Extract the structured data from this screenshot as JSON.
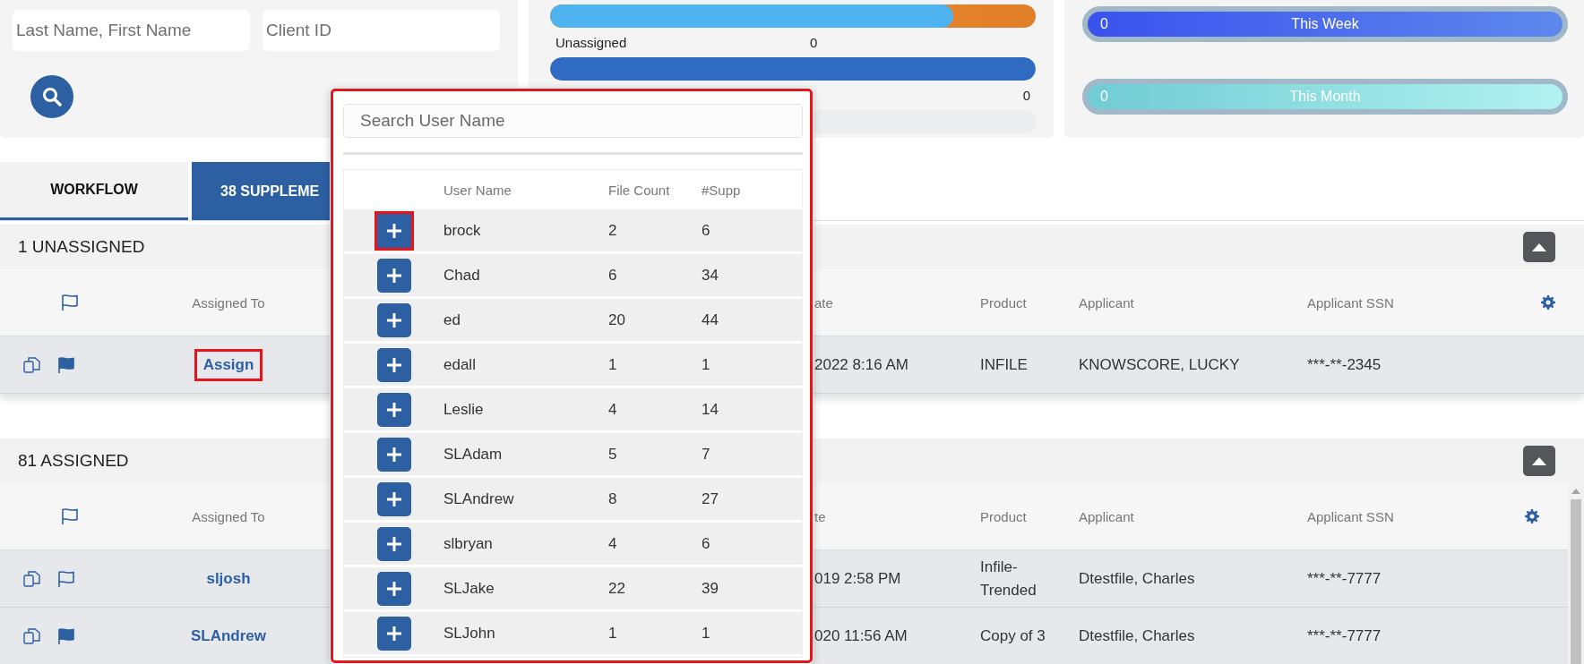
{
  "search_panel": {
    "fields": [
      {
        "placeholder": "Last Name, First Name"
      },
      {
        "placeholder": "Client ID"
      }
    ]
  },
  "status_bars": [
    {
      "kind": "split",
      "level": 0.83
    },
    {
      "kind": "plain",
      "label": "Unassigned",
      "value": "0",
      "level": 1
    },
    {
      "kind": "plain",
      "value": "0",
      "level": 0
    }
  ],
  "period_meters": [
    {
      "kind": "week",
      "value": "0",
      "label": "This Week"
    },
    {
      "kind": "month",
      "value": "0",
      "label": "This Month"
    }
  ],
  "tabs": [
    {
      "label": "WORKFLOW",
      "selected": true
    },
    {
      "label": "38 SUPPLEME",
      "selected": false
    }
  ],
  "sections": [
    {
      "title": "1 UNASSIGNED",
      "expanded": true,
      "assignee_header": "Assigned To",
      "columns": [
        "ate",
        "Product",
        "Applicant",
        "Applicant SSN"
      ],
      "rows": [
        {
          "flagged": true,
          "assigned_to": "Assign",
          "highlighted": true,
          "cells": [
            "2022 8:16 AM",
            "INFILE",
            "KNOWSCORE, LUCKY",
            "***-**-2345"
          ]
        }
      ]
    },
    {
      "title": "81 ASSIGNED",
      "expanded": true,
      "assignee_header": "Assigned To",
      "columns": [
        "te",
        "Product",
        "Applicant",
        "Applicant SSN"
      ],
      "rows": [
        {
          "flagged": false,
          "assigned_to": "sljosh",
          "highlighted": false,
          "cells": [
            "019 2:58 PM",
            "Infile-Trended",
            "Dtestfile, Charles",
            "***-**-7777"
          ]
        },
        {
          "flagged": true,
          "assigned_to": "SLAndrew",
          "highlighted": false,
          "cells": [
            "020 11:56 AM",
            "Copy of 3",
            "Dtestfile, Charles",
            "***-**-7777"
          ]
        }
      ]
    }
  ],
  "user_picker": {
    "highlighted": true,
    "search": {
      "placeholder": "Search User Name"
    },
    "columns": [
      "User Name",
      "File Count",
      "#Supp"
    ],
    "users": [
      {
        "name": "brock",
        "file_count": "2",
        "supp": "6",
        "highlighted": true
      },
      {
        "name": "Chad",
        "file_count": "6",
        "supp": "34",
        "highlighted": false
      },
      {
        "name": "ed",
        "file_count": "20",
        "supp": "44",
        "highlighted": false
      },
      {
        "name": "edall",
        "file_count": "1",
        "supp": "1",
        "highlighted": false
      },
      {
        "name": "Leslie",
        "file_count": "4",
        "supp": "14",
        "highlighted": false
      },
      {
        "name": "SLAdam",
        "file_count": "5",
        "supp": "7",
        "highlighted": false
      },
      {
        "name": "SLAndrew",
        "file_count": "8",
        "supp": "27",
        "highlighted": false
      },
      {
        "name": "slbryan",
        "file_count": "4",
        "supp": "6",
        "highlighted": false
      },
      {
        "name": "SLJake",
        "file_count": "22",
        "supp": "39",
        "highlighted": false
      },
      {
        "name": "SLJohn",
        "file_count": "1",
        "supp": "1",
        "highlighted": false
      }
    ]
  }
}
